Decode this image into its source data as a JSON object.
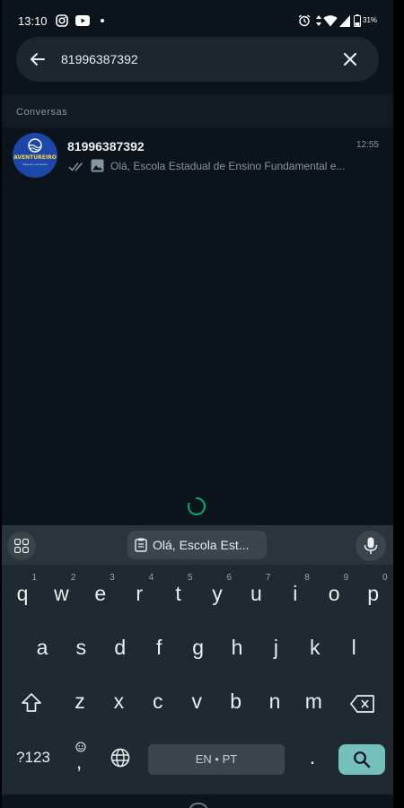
{
  "status_bar": {
    "time": "13:10",
    "battery": "31%",
    "icons": [
      "instagram-icon",
      "youtube-icon",
      "notification-dot-icon",
      "alarm-icon",
      "data-arrows-icon",
      "wifi-icon",
      "signal-icon",
      "battery-icon"
    ]
  },
  "search": {
    "query": "81996387392",
    "back_icon": "arrow-left-icon",
    "clear_icon": "close-icon"
  },
  "section": {
    "label": "Conversas"
  },
  "results": [
    {
      "name": "81996387392",
      "time": "12:55",
      "preview": "Olá, Escola Estadual de Ensino Fundamental e...",
      "avatar_text": "AVENTUREIRO",
      "avatar_subtext": "Viagens e excursões",
      "status_icon": "double-check-icon",
      "media_icon": "photo-icon"
    }
  ],
  "keyboard": {
    "clipboard_suggestion": "Olá, Escola Est...",
    "row1": [
      {
        "key": "q",
        "hint": "1"
      },
      {
        "key": "w",
        "hint": "2"
      },
      {
        "key": "e",
        "hint": "3"
      },
      {
        "key": "r",
        "hint": "4"
      },
      {
        "key": "t",
        "hint": "5"
      },
      {
        "key": "y",
        "hint": "6"
      },
      {
        "key": "u",
        "hint": "7"
      },
      {
        "key": "i",
        "hint": "8"
      },
      {
        "key": "o",
        "hint": "9"
      },
      {
        "key": "p",
        "hint": "0"
      }
    ],
    "row2": [
      "a",
      "s",
      "d",
      "f",
      "g",
      "h",
      "j",
      "k",
      "l"
    ],
    "row3": [
      "z",
      "x",
      "c",
      "v",
      "b",
      "n",
      "m"
    ],
    "symbols_label": "?123",
    "comma_label": ",",
    "space_label": "EN • PT",
    "period_label": ".",
    "colors": {
      "background": "#1e2a30",
      "action_key": "#74c0bc",
      "accent": "#00a884"
    }
  }
}
